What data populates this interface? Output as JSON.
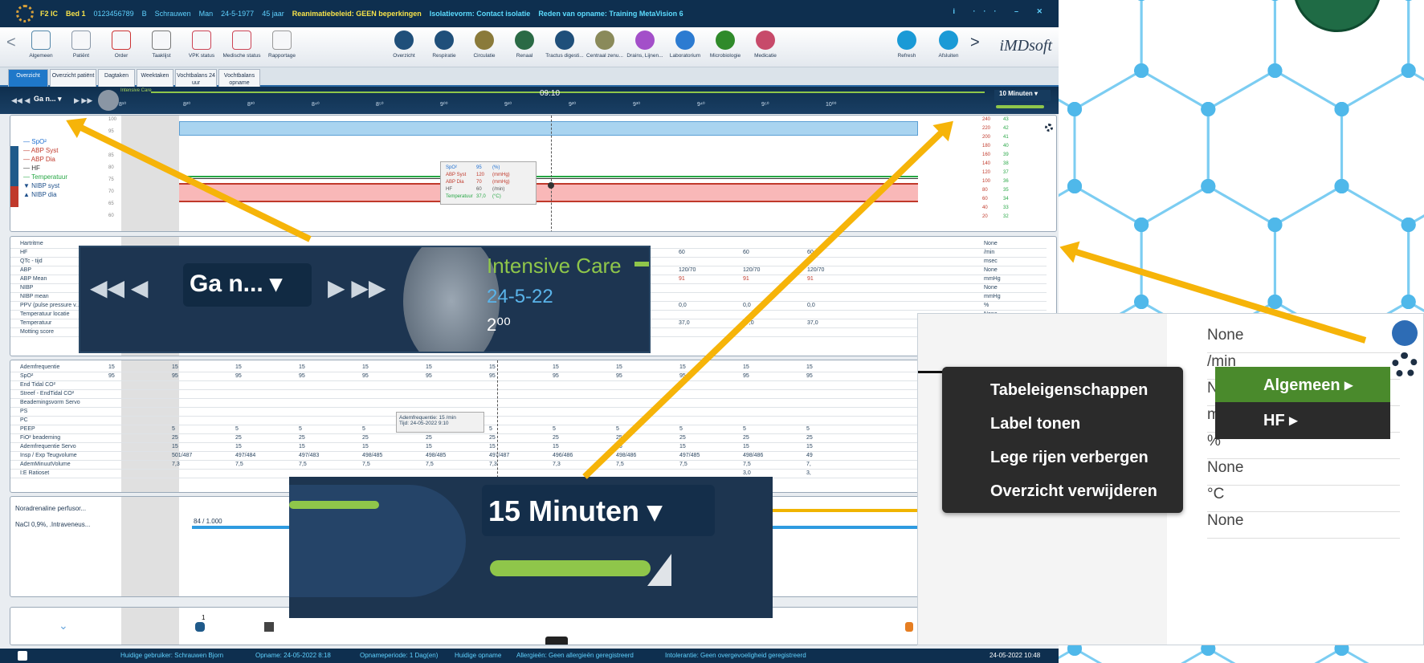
{
  "patient_bar": {
    "unit": "F2 IC",
    "bed": "Bed 1",
    "patient_id": "0123456789",
    "initial": "B",
    "surname": "Schrauwen",
    "gender": "Man",
    "dob": "24-5-1977",
    "age": "45 jaar",
    "resuscitation": "Reanimatiebeleid: GEEN beperkingen",
    "isolation": "Isolatievorm: Contact isolatie",
    "reason": "Reden van opname: Training MetaVision 6",
    "window_controls": "i ··· – ✕"
  },
  "toolbar": {
    "left": [
      "Algemeen",
      "Patiënt",
      "Order",
      "Taaklijst",
      "VPK status",
      "Medische status",
      "Rapportage"
    ],
    "center": [
      "Overzicht",
      "Respiratie",
      "Circulatie",
      "Renaal",
      "Tractus digesti...",
      "Centraal zenu...",
      "Drains, Lijnen...",
      "Laboratorium",
      "Microbiologie",
      "Medicatie"
    ],
    "right": [
      "Refresh",
      "Afsluiten"
    ],
    "brand": "iMDsoft",
    "back": "<",
    "forward": ">"
  },
  "tabs": [
    {
      "label": "Overzicht",
      "active": true
    },
    {
      "label": "Overzicht patiënt",
      "active": false
    },
    {
      "label": "Dagtaken",
      "active": false
    },
    {
      "label": "Weektaken",
      "active": false
    },
    {
      "label": "Vochtbalans 24 uur",
      "active": false
    },
    {
      "label": "Vochtbalans opname",
      "active": false
    }
  ],
  "timeline": {
    "goto": "Ga n...",
    "location": "Intensive Care",
    "date": "24-5-22",
    "hour": "2⁰⁰",
    "current": "09:10",
    "interval": "10 Minuten",
    "ticks": [
      "8¹⁰",
      "8²⁰",
      "8³⁰",
      "8⁴⁰",
      "8⁵⁰",
      "9⁰⁰",
      "9¹⁰",
      "9²⁰",
      "9³⁰",
      "9⁴⁰",
      "9⁵⁰",
      "10⁰⁰"
    ]
  },
  "vitals_chart": {
    "side_tabs": [
      "Overzicht"
    ],
    "legend": [
      "SpO²",
      "ABP Syst",
      "ABP Dia",
      "HF",
      "Temperatuur",
      "NIBP syst",
      "NIBP dia"
    ],
    "y_left": [
      "100",
      "95",
      "90",
      "85",
      "80",
      "75",
      "70",
      "65",
      "60"
    ],
    "y_right_a": [
      "240",
      "220",
      "200",
      "180",
      "160",
      "140",
      "120",
      "100",
      "80",
      "60",
      "40",
      "20"
    ],
    "y_right_b": [
      "43",
      "42",
      "41",
      "40",
      "39",
      "38",
      "37",
      "36",
      "35",
      "34",
      "33",
      "32"
    ],
    "tooltip": [
      [
        "SpO²",
        "95",
        "(%)"
      ],
      [
        "ABP Syst",
        "120",
        "(mmHg)"
      ],
      [
        "ABP Dia",
        "70",
        "(mmHg)"
      ],
      [
        "HF",
        "60",
        "(/min)"
      ],
      [
        "Temperatuur",
        "37,0",
        "(°C)"
      ]
    ]
  },
  "hemo_table": {
    "rows": [
      {
        "label": "Hartritme",
        "unit": "None"
      },
      {
        "label": "HF",
        "unit": "/min"
      },
      {
        "label": "QTc - tijd",
        "unit": "msec"
      },
      {
        "label": "ABP",
        "unit": "None"
      },
      {
        "label": "ABP Mean",
        "unit": "mmHg"
      },
      {
        "label": "NIBP",
        "unit": "None"
      },
      {
        "label": "NIBP mean",
        "unit": "mmHg"
      },
      {
        "label": "PPV (pulse pressure v...",
        "unit": "%"
      },
      {
        "label": "Temperatuur locatie",
        "unit": "None"
      },
      {
        "label": "Temperatuur",
        "unit": "°C"
      },
      {
        "label": "Motting score",
        "unit": "None"
      }
    ],
    "cells": {
      "hf": "60",
      "abp": "120/70",
      "abp_mean": "91",
      "ppv": "0,0",
      "temp": "37,0"
    }
  },
  "resp_table": {
    "rows": [
      "Ademfrequentie",
      "SpO²",
      "End Tidal CO²",
      "Streef - EndTidal CO²",
      "Beademingsvorm Servo",
      "PS",
      "PC",
      "PEEP",
      "FiO² beademing",
      "Ademfrequentie Servo",
      "Insp / Exp Teugvolume",
      "AdemMinuutVolume",
      "I:E Ratioset"
    ],
    "values": {
      "Ademfrequentie": [
        "15",
        "15",
        "15",
        "15",
        "15",
        "15",
        "15",
        "15",
        "15",
        "15",
        "15",
        "15"
      ],
      "SpO²": [
        "95",
        "95",
        "95",
        "95",
        "95",
        "95",
        "95",
        "95",
        "95",
        "95",
        "95",
        "95"
      ],
      "PEEP": [
        "",
        "5",
        "5",
        "5",
        "5",
        "5",
        "5",
        "5",
        "5",
        "5",
        "5",
        "5"
      ],
      "FiO² beademing": [
        "",
        "25",
        "25",
        "25",
        "25",
        "25",
        "25",
        "25",
        "25",
        "25",
        "25",
        "25"
      ],
      "Ademfrequentie Servo": [
        "",
        "15",
        "15",
        "15",
        "15",
        "15",
        "15",
        "15",
        "15",
        "15",
        "15",
        "15"
      ],
      "Insp / Exp Teugvolume": [
        "",
        "501/487",
        "497/484",
        "497/483",
        "498/485",
        "498/485",
        "497/487",
        "496/486",
        "498/486",
        "497/485",
        "498/486",
        "49"
      ],
      "AdemMinuutVolume": [
        "",
        "7,3",
        "7,5",
        "7,5",
        "7,5",
        "7,5",
        "7,3",
        "7,3",
        "7,5",
        "7,5",
        "7,5",
        "7,"
      ],
      "I:E Ratioset": [
        "",
        "",
        "",
        "",
        "",
        "",
        "",
        "",
        "",
        "",
        "3,0",
        "3,"
      ]
    },
    "tooltip": [
      "Ademfrequentie: 15 /min",
      "Tijd: 24-05-2022 9:10"
    ]
  },
  "meds": {
    "rows": [
      "Noradrenaline perfusor...",
      "NaCl 0,9%, .Intraveneus..."
    ],
    "value": "84 / 1.000"
  },
  "events": {
    "marker": "1"
  },
  "status_bar": {
    "user": "Huidige gebruiker: Schrauwen Bjorn",
    "admission": "Opname: 24-05-2022 8:18",
    "period": "Opnameperiode: 1 Dag(en)",
    "current": "Huidige opname",
    "allergies": "Allergieën: Geen allergieën geregistreerd",
    "intolerance": "Intolerantie: Geen overgevoeligheid geregistreerd",
    "datetime": "24-05-2022 10:48"
  },
  "zoom_nav": {
    "goto": "Ga n...",
    "location": "Intensive Care",
    "date": "24-5-22",
    "hour": "2⁰⁰"
  },
  "zoom_interval": {
    "label": "15 Minuten"
  },
  "zoom_menu": {
    "units": [
      "None",
      "/min",
      "None",
      "mmHg",
      "%",
      "None",
      "°C",
      "None"
    ],
    "items": [
      "Tabeleigenschappen",
      "Label tonen",
      "Lege rijen verbergen",
      "Overzicht verwijderen"
    ],
    "submenu": [
      "Algemeen",
      "HF"
    ]
  },
  "colors": {
    "brand_blue": "#0e2f4f",
    "accent_yellow": "#f6b409",
    "hex_blue": "#7ccdf2",
    "menu_green": "#4a8a2c"
  }
}
